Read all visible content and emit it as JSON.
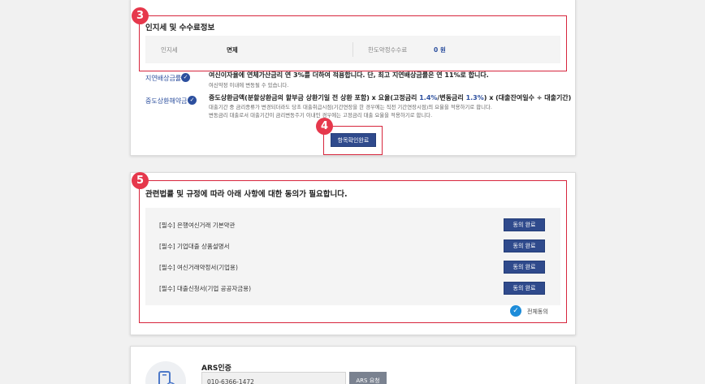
{
  "stamp_section": {
    "title": "인지세 및 수수료정보",
    "stamp_tax_label": "인지세",
    "stamp_tax_value": "면제",
    "limit_fee_label": "한도약정수수료",
    "limit_fee_value": "0 원"
  },
  "fees": {
    "late_label": "지연배상금률",
    "late_main": "여신이자율에 연체가산금리 연 3%를 더하여 적용합니다. 단, 최고 지연배상금률은 연 11%로 합니다.",
    "late_sub": "여신약정 이내에 변동될 수 있습니다.",
    "early_label": "중도상환해약금",
    "early_main_a": "중도상환금액(분할상환금의 할부금 상환기일 전 상환 포함) x 요율(고정금리 ",
    "early_rate_fixed": "1.4%",
    "early_main_b": "/변동금리 ",
    "early_rate_var": "1.3%",
    "early_main_c": ") x (대출잔여일수 ÷ 대출기간)",
    "early_sub1": "대출기간 중 금리종류가 변경되더라도 당초 대출취급시점(기간연장을 한 경우에는 직전 기간연장시점)의 요율을 적용하기로 합니다.",
    "early_sub2": "변동금리 대출로서 대출기간이 금리변동주기 이내인 경우에는 고정금리 대출 요율을 적용하기로 합니다."
  },
  "confirm_button": "항목확인완료",
  "markers": {
    "m3": "3",
    "m4": "4",
    "m5": "5"
  },
  "agreement": {
    "title": "관련법률 및 규정에 따라 아래 사항에 대한 동의가 필요합니다.",
    "items": [
      {
        "label": "[필수] 은행여신거래 기본약관",
        "button": "동의 완료"
      },
      {
        "label": "[필수] 기업대출 상품설명서",
        "button": "동의 완료"
      },
      {
        "label": "[필수] 여신거래약정서(기업용)",
        "button": "동의 완료"
      },
      {
        "label": "[필수] 대출신청서(기업 공공자금용)",
        "button": "동의 완료"
      }
    ],
    "agree_all_label": "전체동의"
  },
  "ars": {
    "title": "ARS인증",
    "phone": "010-6366-1472",
    "button": "ARS 요청"
  },
  "colors": {
    "navy": "#2f4a8c",
    "marker_red": "#e6384c",
    "check_blue": "#1d8cd9",
    "link_blue": "#2c4f9e"
  },
  "icons": {
    "check": "check-icon",
    "phone": "phone-icon"
  }
}
